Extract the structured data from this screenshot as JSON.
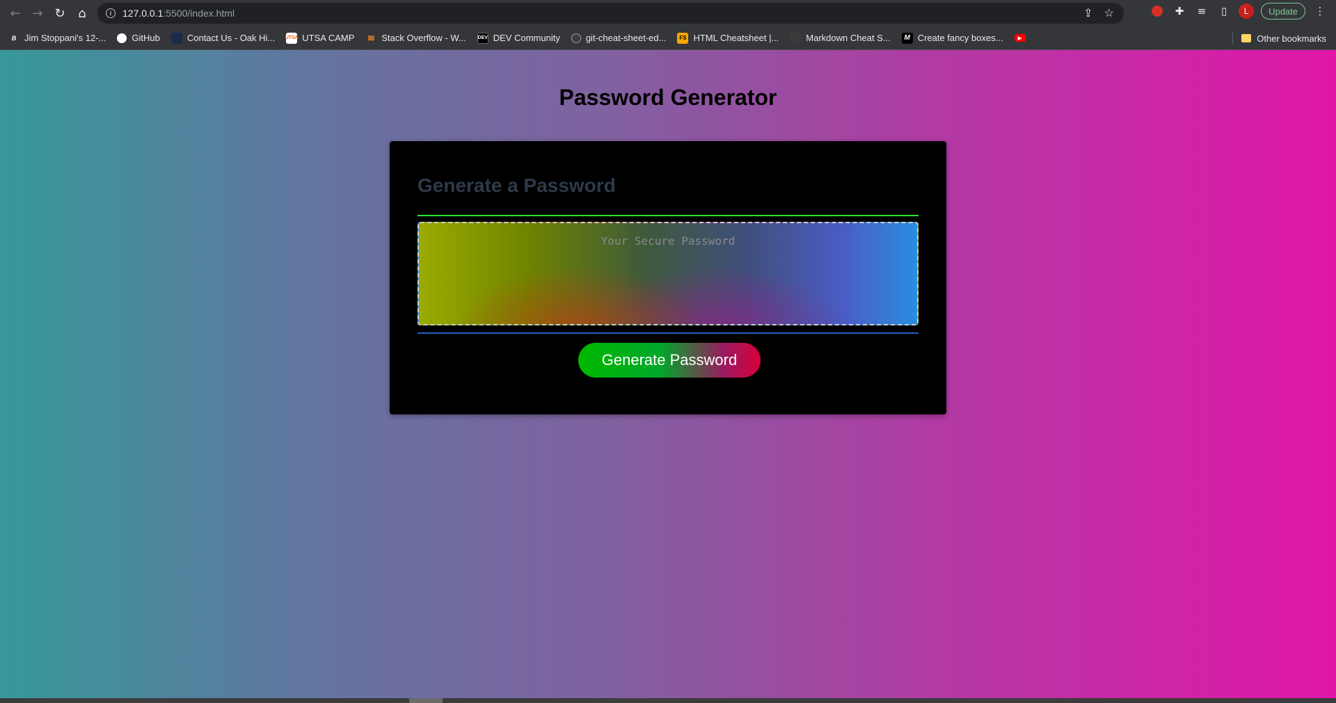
{
  "browser": {
    "url_host": "127.0.0.1",
    "url_rest": ":5500/index.html",
    "update_label": "Update",
    "avatar_letter": "L"
  },
  "bookmarks": [
    {
      "label": "Jim Stoppani's 12-...",
      "icon": "jim-stoppani-favicon",
      "color": "#ffffff"
    },
    {
      "label": "GitHub",
      "icon": "github-icon",
      "color": "#ffffff"
    },
    {
      "label": "Contact Us - Oak Hi...",
      "icon": "oak-hill-favicon",
      "color": "#1a2b4a"
    },
    {
      "label": "UTSA CAMP",
      "icon": "utsa-favicon",
      "color": "#f15a22"
    },
    {
      "label": "Stack Overflow - W...",
      "icon": "stackoverflow-icon",
      "color": "#f48024"
    },
    {
      "label": "DEV Community",
      "icon": "dev-icon",
      "color": "#000000"
    },
    {
      "label": "git-cheat-sheet-ed...",
      "icon": "github-icon",
      "color": "#ffffff"
    },
    {
      "label": "HTML Cheatsheet |...",
      "icon": "html-cheatsheet-favicon",
      "color": "#f7a800"
    },
    {
      "label": "Markdown Cheat S...",
      "icon": "markdown-favicon",
      "color": "#3a3a3a"
    },
    {
      "label": "Create fancy boxes...",
      "icon": "fancy-boxes-favicon",
      "color": "#000000"
    },
    {
      "label": "",
      "icon": "youtube-icon",
      "color": "#ff0000"
    }
  ],
  "bookmarks_other": "Other bookmarks",
  "page": {
    "title": "Password Generator",
    "card_header": "Generate a Password",
    "password_placeholder": "Your Secure Password",
    "password_value": "",
    "generate_button": "Generate Password"
  }
}
